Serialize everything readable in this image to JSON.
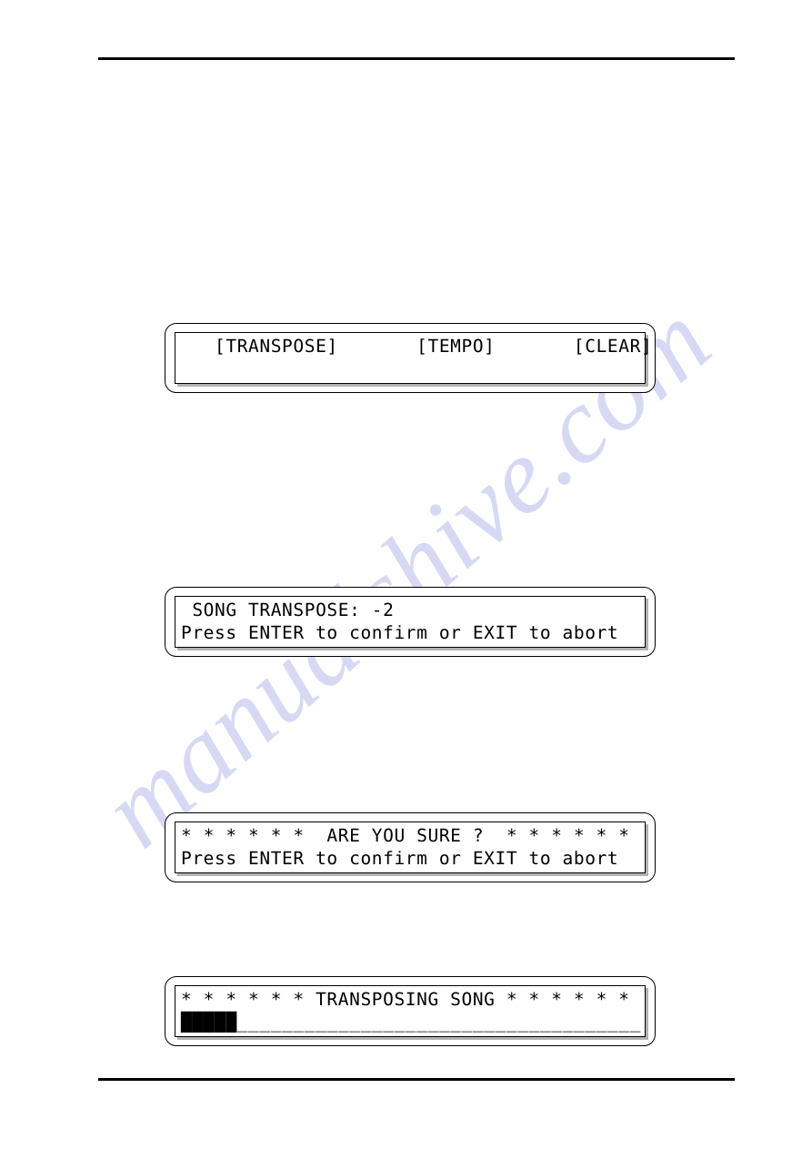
{
  "page": {
    "watermark": "manualshive.com",
    "header_rule": true,
    "footer_rule": true
  },
  "panels": [
    {
      "name": "menu",
      "line1": "   [TRANSPOSE]       [TEMPO]       [CLEAR]",
      "line2": ""
    },
    {
      "name": "transpose-value",
      "line1": " SONG TRANSPOSE: -2",
      "line2": "Press ENTER to confirm or EXIT to abort"
    },
    {
      "name": "are-you-sure",
      "line1": "* * * * * *  ARE YOU SURE ?  * * * * * *",
      "line2": "Press ENTER to confirm or EXIT to abort"
    },
    {
      "name": "transposing-progress",
      "line1": "* * * * * * TRANSPOSING SONG * * * * * *",
      "progress_filled": "█████",
      "progress_empty": "____________________________________"
    }
  ],
  "values": {
    "song_transpose": "-2",
    "progress_blocks_filled": 5,
    "progress_blocks_total": 41
  },
  "labels": {
    "transpose": "[TRANSPOSE]",
    "tempo": "[TEMPO]",
    "clear": "[CLEAR]",
    "confirm_prompt": "Press ENTER to confirm or EXIT to abort",
    "are_you_sure": "ARE YOU SURE ?",
    "transposing_song": "TRANSPOSING SONG",
    "song_transpose_label": "SONG TRANSPOSE:"
  },
  "colors": {
    "ink": "#000000",
    "paper": "#ffffff",
    "watermark": "#c9cbf0"
  }
}
